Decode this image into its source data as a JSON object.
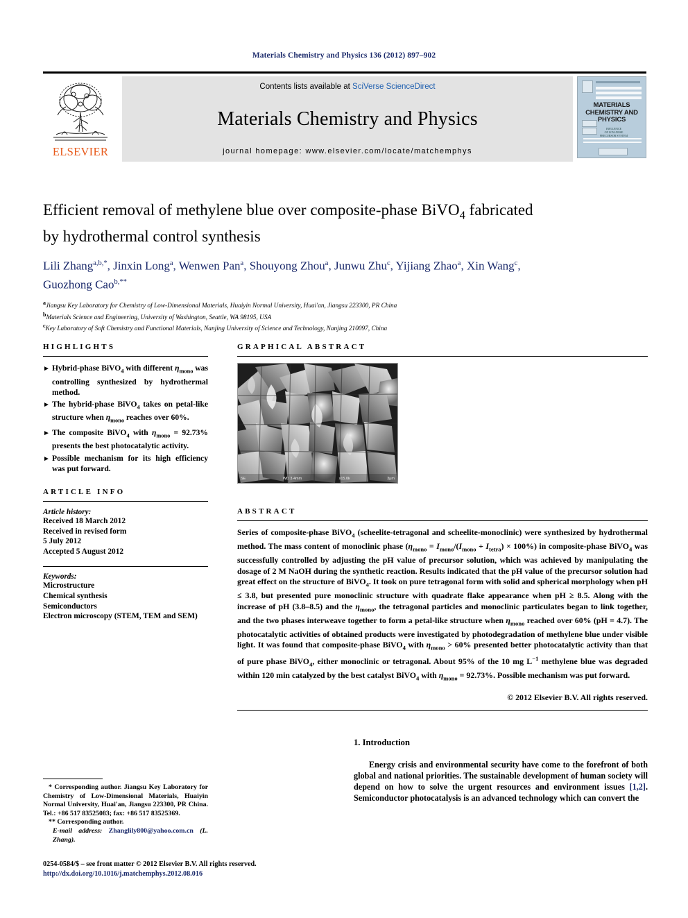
{
  "running_head": "Materials Chemistry and Physics 136 (2012) 897–902",
  "masthead": {
    "publisher": "ELSEVIER",
    "contents_prefix": "Contents lists available at ",
    "contents_link": "SciVerse ScienceDirect",
    "journal_name": "Materials Chemistry and Physics",
    "homepage": "journal homepage: www.elsevier.com/locate/matchemphys",
    "cover_title": "MATERIALS CHEMISTRY AND PHYSICS"
  },
  "article": {
    "title_line1": "Efficient removal of methylene blue over composite-phase BiVO",
    "title_sub1": "4",
    "title_line1_tail": " fabricated",
    "title_line2": "by hydrothermal control synthesis",
    "authors": "Lili Zhang a,b,*, Jinxin Long a, Wenwen Pan a, Shouyong Zhou a, Junwu Zhu c, Yijiang Zhao a, Xin Wang c, Guozhong Cao b,**",
    "affiliations": [
      {
        "mark": "a",
        "text": "Jiangsu Key Laboratory for Chemistry of Low-Dimensional Materials, Huaiyin Normal University, Huai'an, Jiangsu 223300, PR China"
      },
      {
        "mark": "b",
        "text": "Materials Science and Engineering, University of Washington, Seattle, WA 98195, USA"
      },
      {
        "mark": "c",
        "text": "Key Laboratory of Soft Chemistry and Functional Materials, Nanjing University of Science and Technology, Nanjing 210097, China"
      }
    ]
  },
  "highlights": {
    "heading": "HIGHLIGHTS",
    "bullet_glyph": "►",
    "items": [
      "Hybrid-phase BiVO4 with different ηmono was controlling synthesized by hydrothermal method.",
      "The hybrid-phase BiVO4 takes on petal-like structure when ηmono reaches over 60%.",
      "The composite BiVO4 with ηmono = 92.73% presents the best photocatalytic activity.",
      "Possible mechanism for its high efficiency was put forward."
    ]
  },
  "article_info": {
    "heading": "ARTICLE INFO",
    "history_label": "Article history:",
    "history": [
      "Received 18 March 2012",
      "Received in revised form",
      "5 July 2012",
      "Accepted 5 August 2012"
    ],
    "keywords_label": "Keywords:",
    "keywords": [
      "Microstructure",
      "Chemical synthesis",
      "Semiconductors",
      "Electron microscopy (STEM, TEM and SEM)"
    ]
  },
  "graphical_abstract": {
    "heading": "GRAPHICAL ABSTRACT",
    "image_alt": "SEM micrograph of petal-like composite-phase BiVO4",
    "scale_labels": [
      "SE",
      "WD 3.4mm",
      "x15.0k",
      "3μm"
    ]
  },
  "abstract": {
    "heading": "ABSTRACT",
    "text": "Series of composite-phase BiVO4 (scheelite-tetragonal and scheelite-monoclinic) were synthesized by hydrothermal method. The mass content of monoclinic phase (ηmono = Imono/(Imono + Itetra) × 100%) in composite-phase BiVO4 was successfully controlled by adjusting the pH value of precursor solution, which was achieved by manipulating the dosage of 2 M NaOH during the synthetic reaction. Results indicated that the pH value of the precursor solution had great effect on the structure of BiVO4. It took on pure tetragonal form with solid and spherical morphology when pH ≤ 3.8, but presented pure monoclinic structure with quadrate flake appearance when pH ≥ 8.5. Along with the increase of pH (3.8–8.5) and the ηmono, the tetragonal particles and monoclinic particulates began to link together, and the two phases interweave together to form a petal-like structure when ηmono reached over 60% (pH = 4.7). The photocatalytic activities of obtained products were investigated by photodegradation of methylene blue under visible light. It was found that composite-phase BiVO4 with ηmono > 60% presented better photocatalytic activity than that of pure phase BiVO4, either monoclinic or tetragonal. About 95% of the 10 mg L−1 methylene blue was degraded within 120 min catalyzed by the best catalyst BiVO4 with ηmono = 92.73%. Possible mechanism was put forward.",
    "copyright": "© 2012 Elsevier B.V. All rights reserved."
  },
  "introduction": {
    "heading": "1. Introduction",
    "paragraph_part1": "Energy crisis and environmental security have come to the forefront of both global and national priorities. The sustainable development of human society will depend on how to solve the urgent resources and environment issues ",
    "reference": "[1,2]",
    "paragraph_part2": ". Semiconductor photocatalysis is an advanced technology which can convert the"
  },
  "footnotes": {
    "corresponding1": "* Corresponding author. Jiangsu Key Laboratory for Chemistry of Low-Dimensional Materials, Huaiyin Normal University, Huai'an, Jiangsu 223300, PR China. Tel.: +86 517 83525083; fax: +86 517 83525369.",
    "corresponding2": "** Corresponding author.",
    "email_label": "E-mail address:",
    "email": "Zhanglily800@yahoo.com.cn",
    "email_suffix": "(L. Zhang)."
  },
  "footer": {
    "issn": "0254-0584/$ – see front matter © 2012 Elsevier B.V. All rights reserved.",
    "doi": "http://dx.doi.org/10.1016/j.matchemphys.2012.08.016"
  }
}
